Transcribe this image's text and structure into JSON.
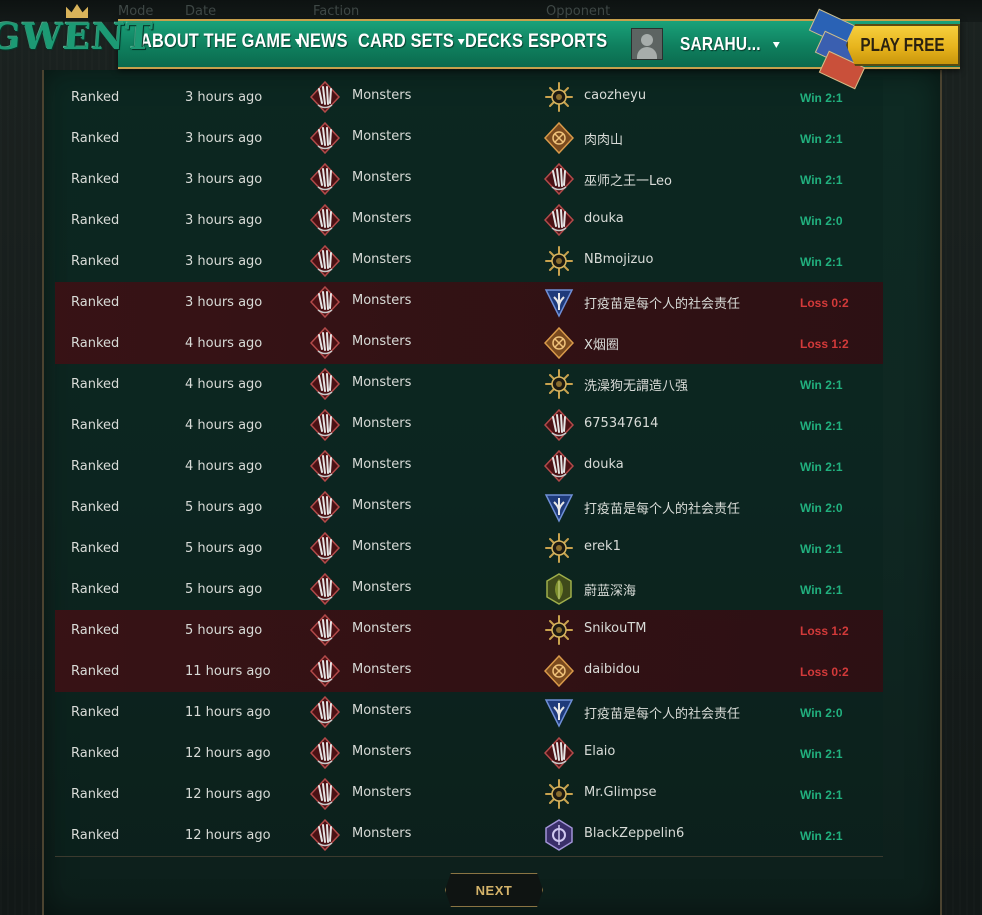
{
  "header": {
    "ghost_labels": [
      "Mode",
      "Date",
      "Faction",
      "Opponent"
    ],
    "logo_text": "GWENT",
    "nav": [
      {
        "label": "ABOUT THE GAME",
        "has_caret": true
      },
      {
        "label": "NEWS",
        "has_caret": false
      },
      {
        "label": "CARD SETS",
        "has_caret": true
      },
      {
        "label": "DECKS",
        "has_caret": false
      },
      {
        "label": "ESPORTS",
        "has_caret": false
      }
    ],
    "username": "SARAHU...",
    "play_free": "PLAY FREE"
  },
  "colors": {
    "win": "#21b07e",
    "loss": "#d43a3a",
    "nav_green": "#0f7f5e",
    "gold": "#c7a04c"
  },
  "matches": [
    {
      "mode": "Ranked",
      "time": "3 hours ago",
      "faction": "Monsters",
      "faction_icon": "monsters-claw-icon",
      "opponent": "caozheyu",
      "opponent_icon": "nilfgaard-sun-icon",
      "result": "Win 2:1",
      "outcome": "win"
    },
    {
      "mode": "Ranked",
      "time": "3 hours ago",
      "faction": "Monsters",
      "faction_icon": "monsters-claw-icon",
      "opponent": "肉肉山",
      "opponent_icon": "syndicate-coin-icon",
      "result": "Win 2:1",
      "outcome": "win"
    },
    {
      "mode": "Ranked",
      "time": "3 hours ago",
      "faction": "Monsters",
      "faction_icon": "monsters-claw-icon",
      "opponent": "巫师之王一Leo",
      "opponent_icon": "monsters-claw-icon",
      "result": "Win 2:1",
      "outcome": "win"
    },
    {
      "mode": "Ranked",
      "time": "3 hours ago",
      "faction": "Monsters",
      "faction_icon": "monsters-claw-icon",
      "opponent": "douka",
      "opponent_icon": "monsters-claw-icon",
      "result": "Win 2:0",
      "outcome": "win"
    },
    {
      "mode": "Ranked",
      "time": "3 hours ago",
      "faction": "Monsters",
      "faction_icon": "monsters-claw-icon",
      "opponent": "NBmojizuo",
      "opponent_icon": "nilfgaard-sun-icon",
      "result": "Win 2:1",
      "outcome": "win"
    },
    {
      "mode": "Ranked",
      "time": "3 hours ago",
      "faction": "Monsters",
      "faction_icon": "monsters-claw-icon",
      "opponent": "打疫苗是每个人的社会责任",
      "opponent_icon": "northern-realms-lily-icon",
      "result": "Loss 0:2",
      "outcome": "loss"
    },
    {
      "mode": "Ranked",
      "time": "4 hours ago",
      "faction": "Monsters",
      "faction_icon": "monsters-claw-icon",
      "opponent": "X烟圈",
      "opponent_icon": "syndicate-coin-icon",
      "result": "Loss 1:2",
      "outcome": "loss"
    },
    {
      "mode": "Ranked",
      "time": "4 hours ago",
      "faction": "Monsters",
      "faction_icon": "monsters-claw-icon",
      "opponent": "洗澡狗无謂造八强",
      "opponent_icon": "nilfgaard-sun-icon",
      "result": "Win 2:1",
      "outcome": "win"
    },
    {
      "mode": "Ranked",
      "time": "4 hours ago",
      "faction": "Monsters",
      "faction_icon": "monsters-claw-icon",
      "opponent": "675347614",
      "opponent_icon": "monsters-claw-icon",
      "result": "Win 2:1",
      "outcome": "win"
    },
    {
      "mode": "Ranked",
      "time": "4 hours ago",
      "faction": "Monsters",
      "faction_icon": "monsters-claw-icon",
      "opponent": "douka",
      "opponent_icon": "monsters-claw-icon",
      "result": "Win 2:1",
      "outcome": "win"
    },
    {
      "mode": "Ranked",
      "time": "5 hours ago",
      "faction": "Monsters",
      "faction_icon": "monsters-claw-icon",
      "opponent": "打疫苗是每个人的社会责任",
      "opponent_icon": "northern-realms-lily-icon",
      "result": "Win 2:0",
      "outcome": "win"
    },
    {
      "mode": "Ranked",
      "time": "5 hours ago",
      "faction": "Monsters",
      "faction_icon": "monsters-claw-icon",
      "opponent": "erek1",
      "opponent_icon": "nilfgaard-sun-icon",
      "result": "Win 2:1",
      "outcome": "win"
    },
    {
      "mode": "Ranked",
      "time": "5 hours ago",
      "faction": "Monsters",
      "faction_icon": "monsters-claw-icon",
      "opponent": "蔚蓝深海",
      "opponent_icon": "scoiatael-leaf-icon",
      "result": "Win 2:1",
      "outcome": "win"
    },
    {
      "mode": "Ranked",
      "time": "5 hours ago",
      "faction": "Monsters",
      "faction_icon": "monsters-claw-icon",
      "opponent": "SnikouTM",
      "opponent_icon": "nilfgaard-sun-icon",
      "result": "Loss 1:2",
      "outcome": "loss"
    },
    {
      "mode": "Ranked",
      "time": "11 hours ago",
      "faction": "Monsters",
      "faction_icon": "monsters-claw-icon",
      "opponent": "daibidou",
      "opponent_icon": "syndicate-coin-icon",
      "result": "Loss 0:2",
      "outcome": "loss"
    },
    {
      "mode": "Ranked",
      "time": "11 hours ago",
      "faction": "Monsters",
      "faction_icon": "monsters-claw-icon",
      "opponent": "打疫苗是每个人的社会责任",
      "opponent_icon": "northern-realms-lily-icon",
      "result": "Win 2:0",
      "outcome": "win"
    },
    {
      "mode": "Ranked",
      "time": "12 hours ago",
      "faction": "Monsters",
      "faction_icon": "monsters-claw-icon",
      "opponent": "Elaio",
      "opponent_icon": "monsters-claw-icon",
      "result": "Win 2:1",
      "outcome": "win"
    },
    {
      "mode": "Ranked",
      "time": "12 hours ago",
      "faction": "Monsters",
      "faction_icon": "monsters-claw-icon",
      "opponent": "Mr.Glimpse",
      "opponent_icon": "nilfgaard-sun-icon",
      "result": "Win 2:1",
      "outcome": "win"
    },
    {
      "mode": "Ranked",
      "time": "12 hours ago",
      "faction": "Monsters",
      "faction_icon": "monsters-claw-icon",
      "opponent": "BlackZeppelin6",
      "opponent_icon": "skellige-axe-icon",
      "result": "Win 2:1",
      "outcome": "win"
    }
  ],
  "pagination": {
    "next_label": "NEXT"
  }
}
